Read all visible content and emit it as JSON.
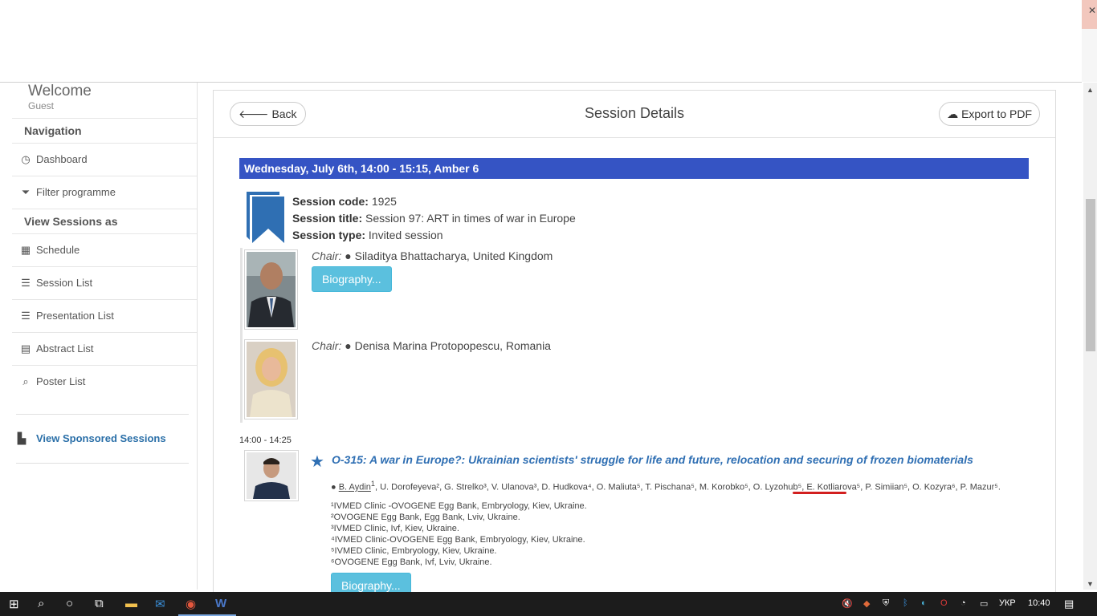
{
  "sidebar": {
    "welcome": "Welcome",
    "user": "Guest",
    "navigation_heading": "Navigation",
    "nav_items": [
      {
        "label": "Dashboard",
        "icon": "clock-icon"
      },
      {
        "label": "Filter programme",
        "icon": "filter-icon"
      }
    ],
    "view_heading": "View Sessions as",
    "view_items": [
      {
        "label": "Schedule",
        "icon": "grid-icon"
      },
      {
        "label": "Session List",
        "icon": "list-icon"
      },
      {
        "label": "Presentation List",
        "icon": "list-icon"
      },
      {
        "label": "Abstract List",
        "icon": "document-icon"
      },
      {
        "label": "Poster List",
        "icon": "search-icon"
      }
    ],
    "sponsored": "View Sponsored Sessions"
  },
  "panel": {
    "back_label": "Back",
    "title": "Session Details",
    "export_label": "Export to PDF"
  },
  "session": {
    "header": "Wednesday, July 6th, 14:00 - 15:15, Amber 6",
    "code_label": "Session code:",
    "code": "1925",
    "title_label": "Session title:",
    "title": "Session 97: ART in times of war in Europe",
    "type_label": "Session type:",
    "type": "Invited session"
  },
  "chairs": [
    {
      "label": "Chair:",
      "name": "Siladitya Bhattacharya, United Kingdom",
      "bio": "Biography..."
    },
    {
      "label": "Chair:",
      "name": "Denisa Marina Protopopescu, Romania"
    }
  ],
  "presentation": {
    "time": "14:00 - 14:25",
    "title": "O-315: A war in Europe?: Ukrainian scientists' struggle for life and future, relocation and securing of frozen biomaterials",
    "presenter": "B. Aydin",
    "presenter_sup": "1",
    "authors_rest": ", U. Dorofeyeva², G. Strelko³, V. Ulanova³, D. Hudkova⁴, O. Maliuta⁵, T. Pischana⁵, M. Korobko⁵, O. Lyzohub⁵, E. Kotliarova⁵, P. Simiian⁵, O. Kozyra⁶, P. Mazur⁵.",
    "affiliations": [
      "¹IVMED Clinic -OVOGENE Egg Bank, Embryology, Kiev, Ukraine.",
      "²OVOGENE Egg Bank, Egg Bank, Lviv, Ukraine.",
      "³IVMED Clinic, Ivf, Kiev, Ukraine.",
      "⁴IVMED Clinic-OVOGENE Egg Bank, Embryology, Kiev, Ukraine.",
      "⁵IVMED Clinic, Embryology, Kiev, Ukraine.",
      "⁶OVOGENE Egg Bank, Ivf, Lviv, Ukraine."
    ],
    "bio": "Biography..."
  },
  "taskbar": {
    "language": "УКР",
    "time": "10:40"
  },
  "colors": {
    "session_bar": "#3554c4",
    "link": "#2f6fb3",
    "bio_button": "#5bc0de"
  }
}
